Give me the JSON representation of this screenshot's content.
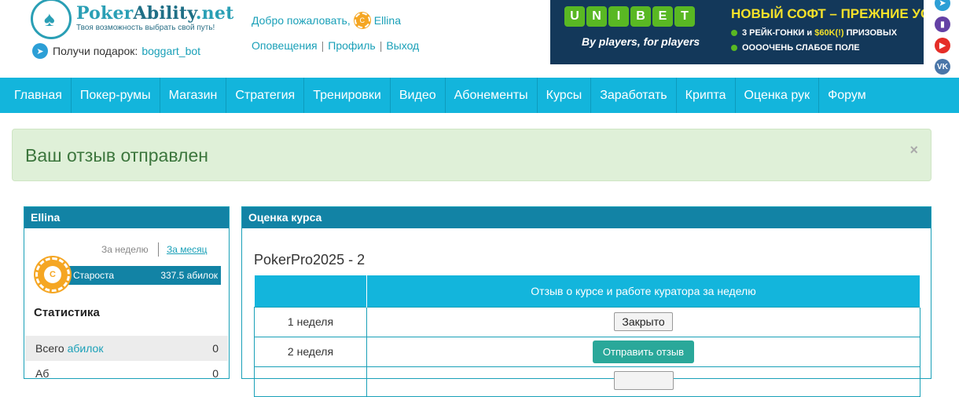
{
  "header": {
    "logo_title_a": "Poker",
    "logo_title_b": "Ability",
    "logo_title_c": ".net",
    "logo_subtitle": "Твоя возможность выбрать свой путь!",
    "gift_text": "Получи подарок:",
    "gift_link": "boggart_bot",
    "welcome_text": "Добро пожаловать,",
    "username": "Ellina",
    "links": [
      "Оповещения",
      "Профиль",
      "Выход"
    ]
  },
  "banner": {
    "brand_letters": [
      "U",
      "N",
      "I",
      "B",
      "E",
      "T"
    ],
    "tagline": "By players, for players",
    "title": "НОВЫЙ СОФТ – ПРЕЖНИЕ УСЛОВИЯ:",
    "line1_a": "3 РЕЙК-ГОНКИ и",
    "line1_b": "$60K(!)",
    "line1_c": "ПРИЗОВЫХ",
    "line2": "ООООЧЕНЬ СЛАБОЕ ПОЛЕ"
  },
  "socials": [
    {
      "icon": "telegram-icon",
      "color": "#2c9fd6",
      "glyph": "➤"
    },
    {
      "icon": "twitch-icon",
      "color": "#6441a5",
      "glyph": "▮"
    },
    {
      "icon": "youtube-icon",
      "color": "#e52d27",
      "glyph": "▶"
    },
    {
      "icon": "vk-icon",
      "color": "#4a76a8",
      "glyph": "VK"
    }
  ],
  "nav": [
    "Главная",
    "Покер-румы",
    "Магазин",
    "Стратегия",
    "Тренировки",
    "Видео",
    "Абонементы",
    "Курсы",
    "Заработать",
    "Крипта",
    "Оценка рук",
    "Форум"
  ],
  "alert": {
    "message": "Ваш отзыв отправлен",
    "close": "×"
  },
  "profile": {
    "title": "Ellina",
    "period_week": "За неделю",
    "period_month": "За месяц",
    "rank_label": "Староста",
    "rank_value": "337.5 абилок",
    "chip_letter": "C",
    "stats_title": "Статистика",
    "stats": [
      {
        "label_a": "Всего",
        "label_b": "абилок",
        "value": "0"
      },
      {
        "label_a": "Аб",
        "label_b": "",
        "value": "0"
      }
    ]
  },
  "course": {
    "panel_title": "Оценка курса",
    "name": "PokerPro2025 - 2",
    "column_header": "Отзыв о курсе и работе куратора за неделю",
    "rows": [
      {
        "week": "1 неделя",
        "action": "Закрыто",
        "type": "closed"
      },
      {
        "week": "2 неделя",
        "action": "Отправить отзыв",
        "type": "send"
      },
      {
        "week": "",
        "action": "",
        "type": "closed"
      }
    ]
  },
  "colors": {
    "accent": "#13b5dc",
    "dark_accent": "#1283a5",
    "success_bg": "#dff0d8",
    "success_text": "#3c763d",
    "send_button": "#2aa89a",
    "chip": "#f5a623"
  }
}
